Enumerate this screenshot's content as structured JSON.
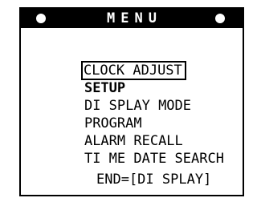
{
  "menu": {
    "title": "MENU",
    "items": [
      {
        "label": "CLOCK ADJUST",
        "selected": true
      },
      {
        "label": "SETUP",
        "selected": false
      },
      {
        "label": "DI SPLAY MODE",
        "selected": false
      },
      {
        "label": "PROGRAM",
        "selected": false
      },
      {
        "label": "ALARM RECALL",
        "selected": false
      },
      {
        "label": "TI ME DATE SEARCH",
        "selected": false
      }
    ],
    "footer": "END=[DI SPLAY]"
  },
  "colors": {
    "background": "#ffffff",
    "foreground": "#000000"
  }
}
